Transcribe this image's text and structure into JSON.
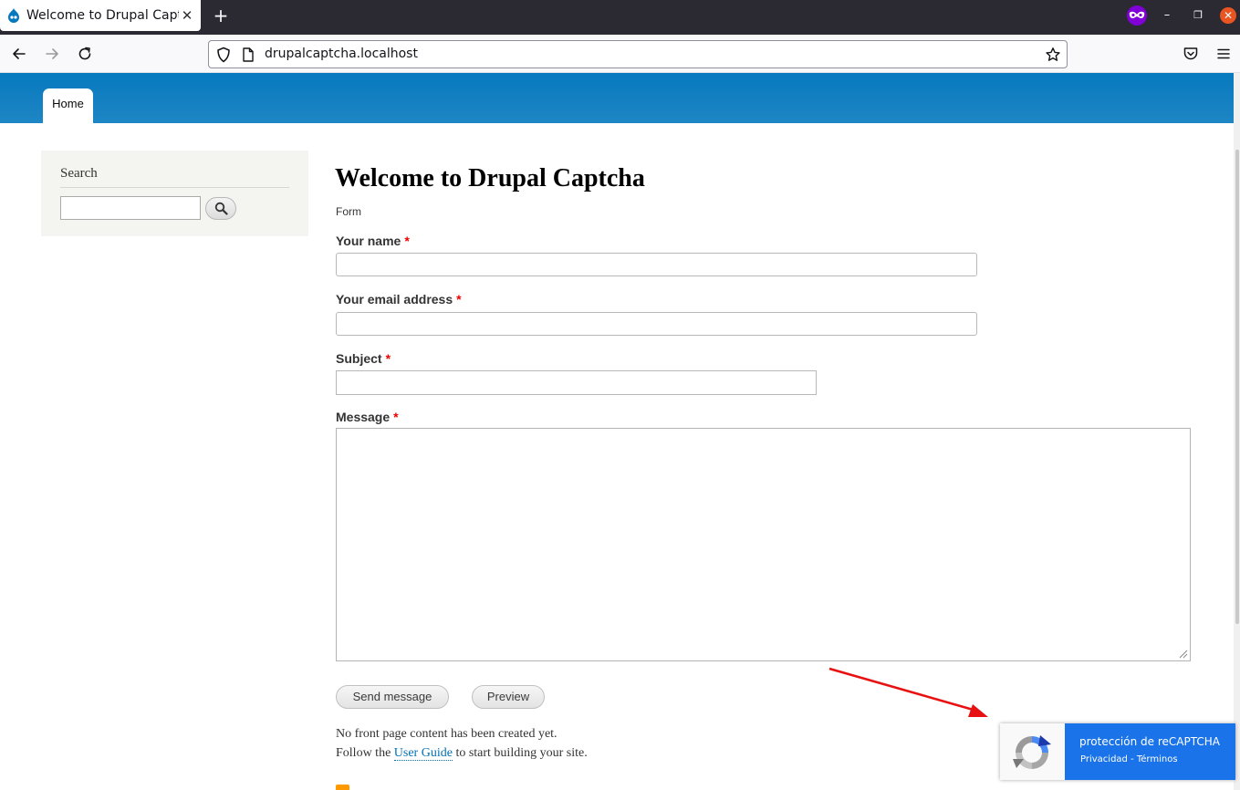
{
  "browser": {
    "tab_title": "Welcome to Drupal Captcha",
    "tab_close": "✕",
    "new_tab": "+",
    "url": "drupalcaptcha.localhost",
    "window_min": "–",
    "window_max": "❐",
    "window_close": "✕",
    "icons": [
      "drupal-favicon",
      "back-arrow-icon",
      "forward-arrow-icon",
      "reload-icon",
      "shield-icon",
      "page-icon",
      "bookmark-star-icon",
      "private-browsing-icon",
      "pocket-icon",
      "hamburger-menu-icon"
    ]
  },
  "header": {
    "home_tab": "Home",
    "color": "#0779bf"
  },
  "sidebar": {
    "search_title": "Search",
    "search_value": ""
  },
  "main": {
    "title": "Welcome to Drupal Captcha",
    "breadcrumb": "Form",
    "required_marker": "*",
    "fields": {
      "name_label": "Your name",
      "email_label": "Your email address",
      "subject_label": "Subject",
      "message_label": "Message"
    },
    "buttons": {
      "send": "Send message",
      "preview": "Preview"
    },
    "info": {
      "line1": "No front page content has been created yet.",
      "line2_before": "Follow the",
      "line2_link": "User Guide",
      "line2_after": "to start building your site."
    }
  },
  "recaptcha": {
    "text_prefix": "protección de ",
    "text_brand": "reCAPTCHA",
    "privacy": "Privacidad",
    "separator": " - ",
    "terms": "Términos",
    "accent": "#1a73e8"
  },
  "annotation": {
    "arrow_color": "#e81111"
  }
}
